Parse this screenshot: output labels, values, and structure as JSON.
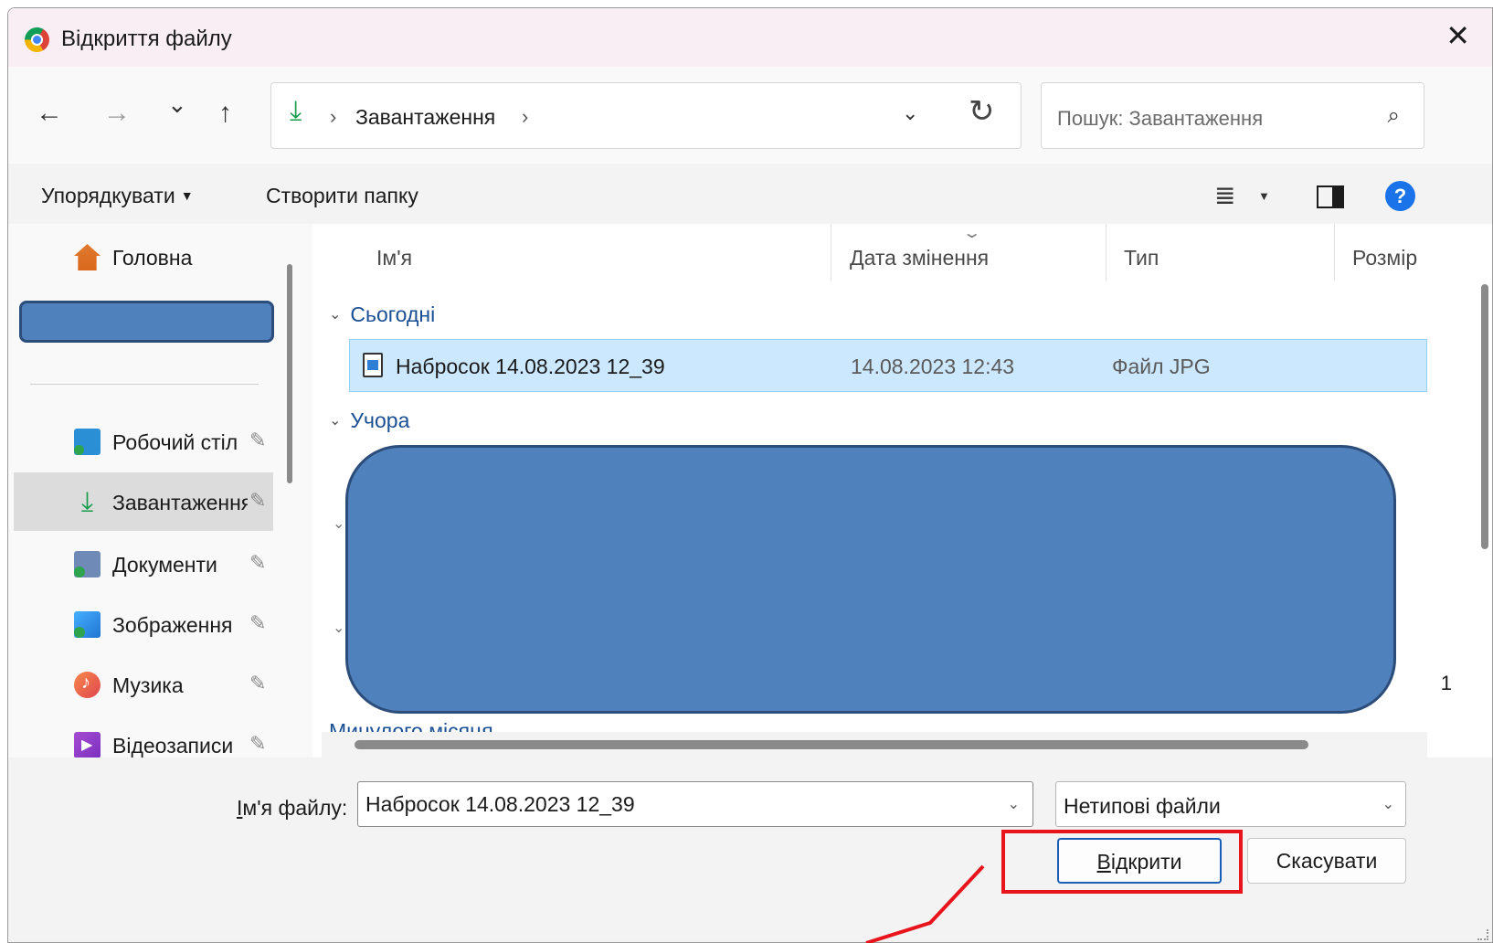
{
  "window": {
    "title": "Відкриття файлу",
    "close_glyph": "✕"
  },
  "nav": {
    "back_glyph": "←",
    "forward_glyph": "→",
    "recent_glyph": "⌄",
    "up_glyph": "↑",
    "address": {
      "location_icon": "download-icon",
      "path": "Завантаження",
      "separator": "›",
      "dropdown_glyph": "⌄",
      "refresh_glyph": "↻"
    },
    "search": {
      "placeholder": "Пошук: Завантаження",
      "icon_glyph": "⌕"
    }
  },
  "toolbar": {
    "organize_label": "Упорядкувати",
    "organize_caret": "▼",
    "new_folder_label": "Створити папку",
    "view_glyph": "≣",
    "view_caret": "▼",
    "help_glyph": "?"
  },
  "sidebar": {
    "home_label": "Головна",
    "pin_glyph": "📌",
    "items": [
      {
        "label": "Робочий стіл",
        "icon": "desktop-icon"
      },
      {
        "label": "Завантаження",
        "icon": "download-icon"
      },
      {
        "label": "Документи",
        "icon": "documents-icon"
      },
      {
        "label": "Зображення",
        "icon": "images-icon"
      },
      {
        "label": "Музика",
        "icon": "music-icon"
      },
      {
        "label": "Відеозаписи",
        "icon": "video-icon"
      }
    ],
    "selected_index": 1
  },
  "filelist": {
    "columns": {
      "name": "Ім'я",
      "date": "Дата змінення",
      "type": "Тип",
      "size": "Розмір"
    },
    "sort_glyph": "⌄",
    "group_chevron": "⌄",
    "groups": [
      {
        "label": "Сьогодні"
      },
      {
        "label": "Учора"
      },
      {
        "label": "Минулого місяця"
      }
    ],
    "files": [
      {
        "name": "Набросок 14.08.2023 12_39",
        "date": "14.08.2023 12:43",
        "type": "Файл JPG",
        "size": ""
      }
    ],
    "stray_value": "1"
  },
  "bottom": {
    "filename_label_prefix": "І",
    "filename_label_rest": "м'я файлу:",
    "filename_value": "Набросок 14.08.2023 12_39",
    "filetype_value": "Нетипові файли",
    "dropdown_glyph": "⌄",
    "open_label_prefix": "В",
    "open_label_rest": "ідкрити",
    "cancel_label": "Скасувати"
  },
  "colors": {
    "accent": "#1a5fb4",
    "selection": "#cce8ff",
    "redaction": "#4f81bd",
    "annotation": "#e8141c",
    "download_green": "#169c4a"
  }
}
